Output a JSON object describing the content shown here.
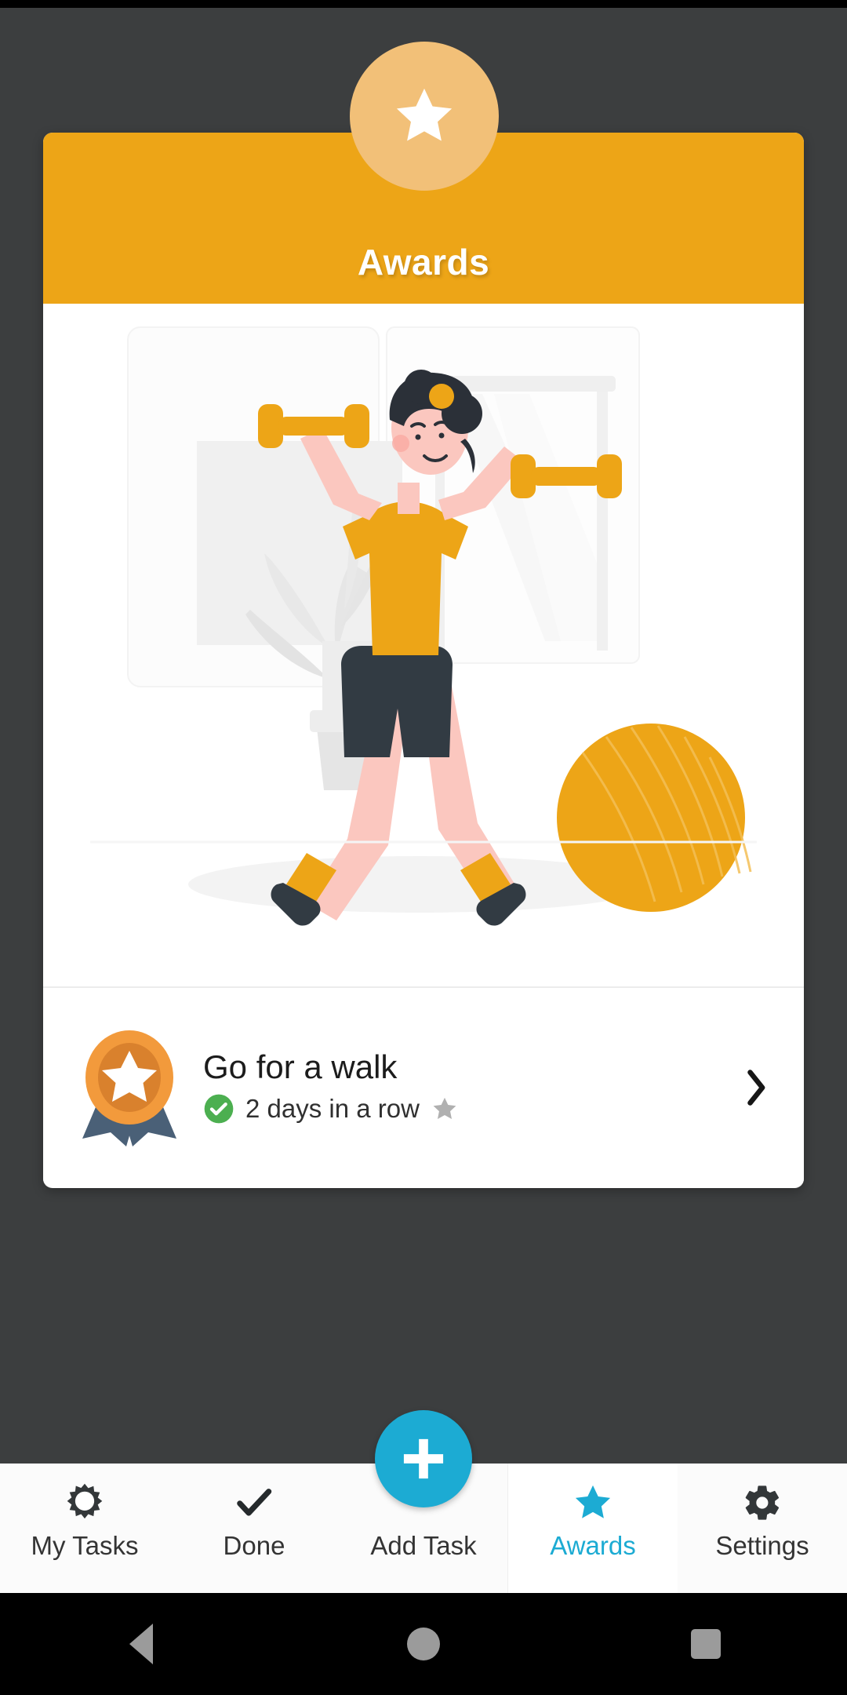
{
  "app": {
    "background_color": "#3c3e3f",
    "accent_orange": "#eda517",
    "accent_cyan": "#1cabd3"
  },
  "header": {
    "badge_icon": "star-icon",
    "badge_color": "#f2c078",
    "title": "Awards",
    "bar_color": "#eda517"
  },
  "illustration": {
    "name": "woman-exercising-with-dumbbells-illustration",
    "alt": "Woman lifting dumbbells next to a plant, window and exercise ball"
  },
  "awards": [
    {
      "medal_icon": "medal-star-icon",
      "title": "Go for a walk",
      "status_icon": "check-circle-icon",
      "status_color": "#4caf50",
      "streak_text": "2 days in a row",
      "rank_icon": "star-icon",
      "rank_color": "#b0b0b0",
      "chevron_icon": "chevron-right-icon"
    }
  ],
  "fab": {
    "icon": "plus-icon",
    "color": "#1cabd3",
    "label": "Add Task"
  },
  "bottom_nav": {
    "items": [
      {
        "label": "My Tasks",
        "icon": "sun-burst-icon",
        "active": false
      },
      {
        "label": "Done",
        "icon": "check-icon",
        "active": false
      },
      {
        "label": "Add Task",
        "icon": "plus-icon",
        "active": false
      },
      {
        "label": "Awards",
        "icon": "star-icon",
        "active": true
      },
      {
        "label": "Settings",
        "icon": "gear-icon",
        "active": false
      }
    ]
  },
  "system_nav": {
    "back": "back-icon",
    "home": "home-icon",
    "recents": "recents-icon"
  }
}
